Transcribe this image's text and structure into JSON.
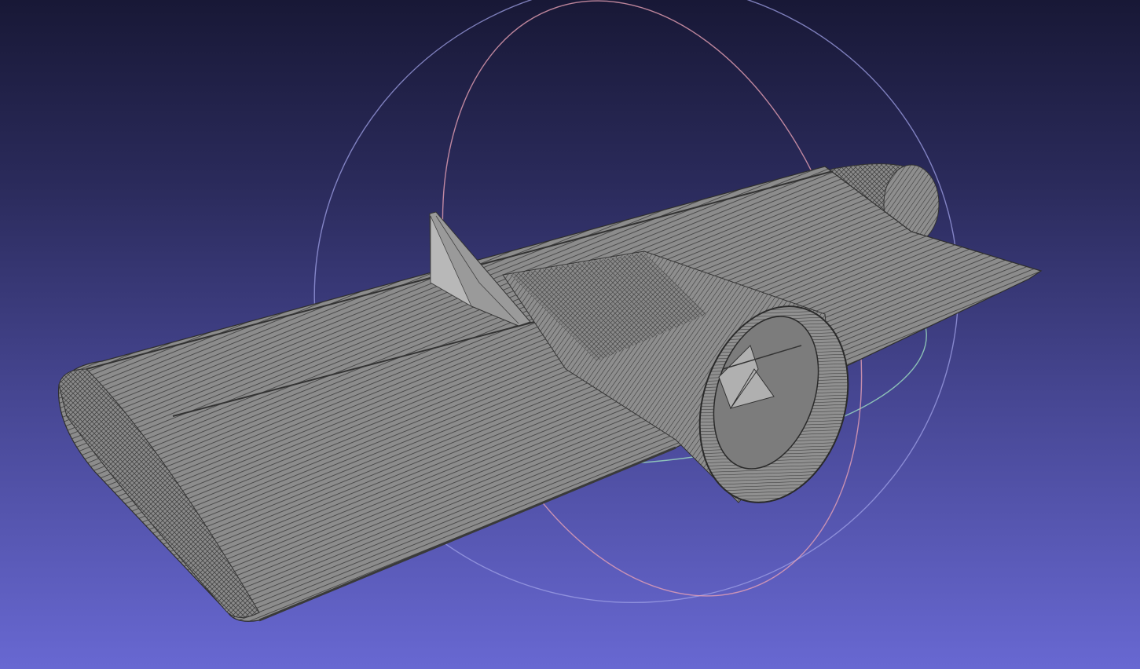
{
  "viewport": {
    "background_top": "#181836",
    "background_bottom": "#6868d2",
    "mesh_fill": "#8a8a8a",
    "mesh_line": "#3a3a3a",
    "trackball_colors": {
      "x_ring": "#e8a0b0",
      "y_ring": "#a0e0c0",
      "z_ring": "#a8a8f0"
    }
  },
  "model": {
    "parts": [
      "wing",
      "engine-nacelle",
      "vertical-fin",
      "intake",
      "exhaust"
    ]
  }
}
